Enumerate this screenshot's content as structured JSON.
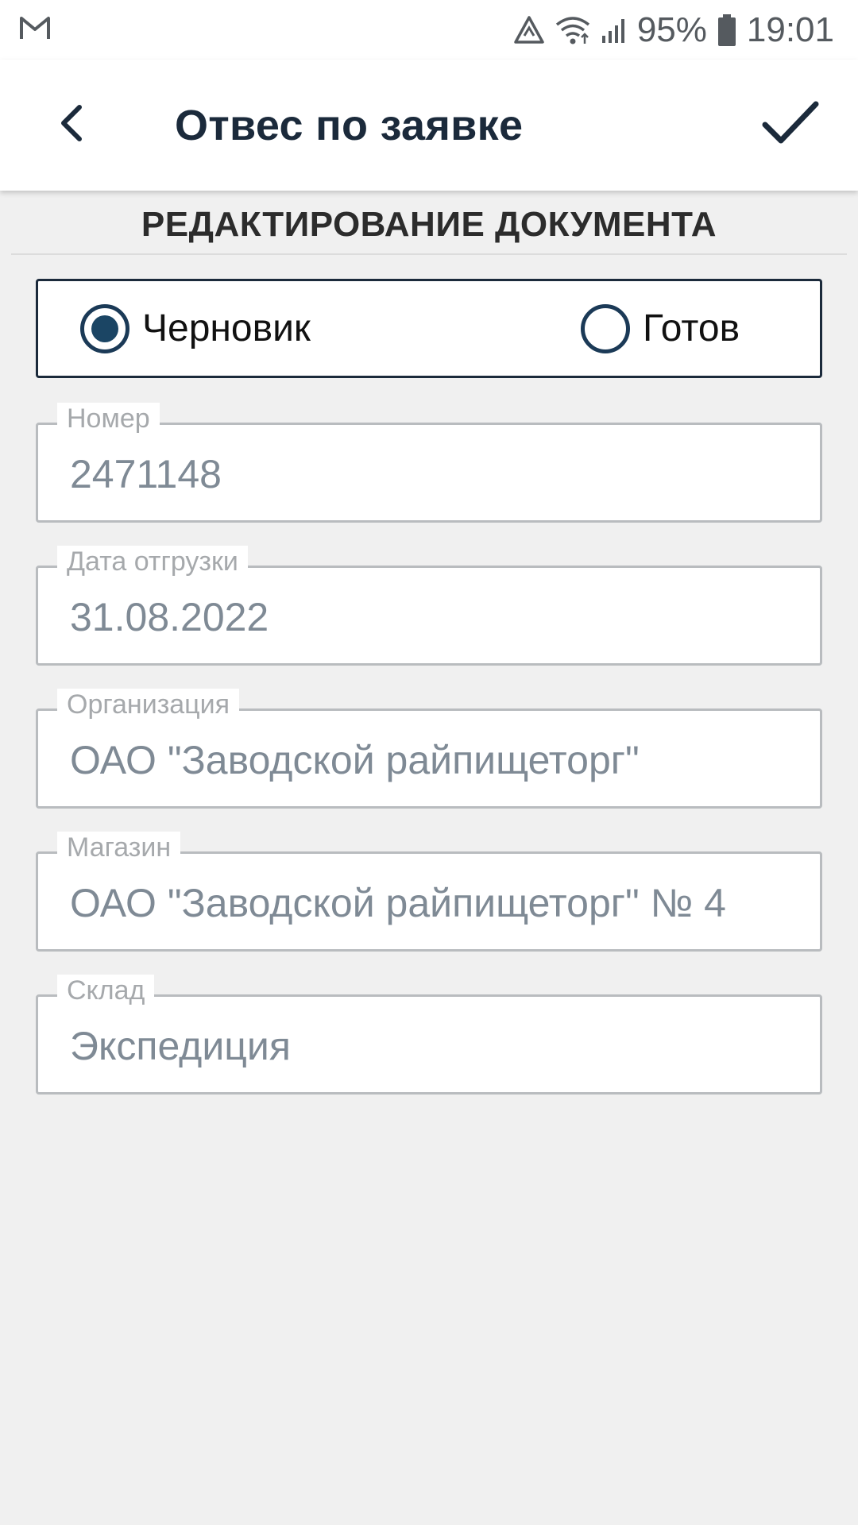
{
  "status_bar": {
    "battery": "95%",
    "time": "19:01",
    "icons": [
      "gmail-icon",
      "data-saver-icon",
      "wifi-icon",
      "cell-signal-icon",
      "battery-icon"
    ]
  },
  "app_bar": {
    "title": "Отвес по заявке",
    "back_icon": "chevron-left-icon",
    "confirm_icon": "check-icon"
  },
  "section": {
    "title": "РЕДАКТИРОВАНИЕ ДОКУМЕНТА"
  },
  "document_status": {
    "options": [
      {
        "label": "Черновик",
        "selected": true
      },
      {
        "label": "Готов",
        "selected": false
      }
    ]
  },
  "fields": [
    {
      "label": "Номер",
      "value": "2471148"
    },
    {
      "label": "Дата отгрузки",
      "value": "31.08.2022"
    },
    {
      "label": "Организация",
      "value": "ОАО \"Заводской райпищеторг\""
    },
    {
      "label": "Магазин",
      "value": "ОАО \"Заводской райпищеторг\" № 4"
    },
    {
      "label": "Склад",
      "value": "Экспедиция"
    }
  ],
  "colors": {
    "primary": "#1b2a3b",
    "radio_fill": "#1b4564",
    "field_border": "#b9bcbf",
    "field_text": "#7f8a95",
    "background": "#f0f0f0"
  }
}
